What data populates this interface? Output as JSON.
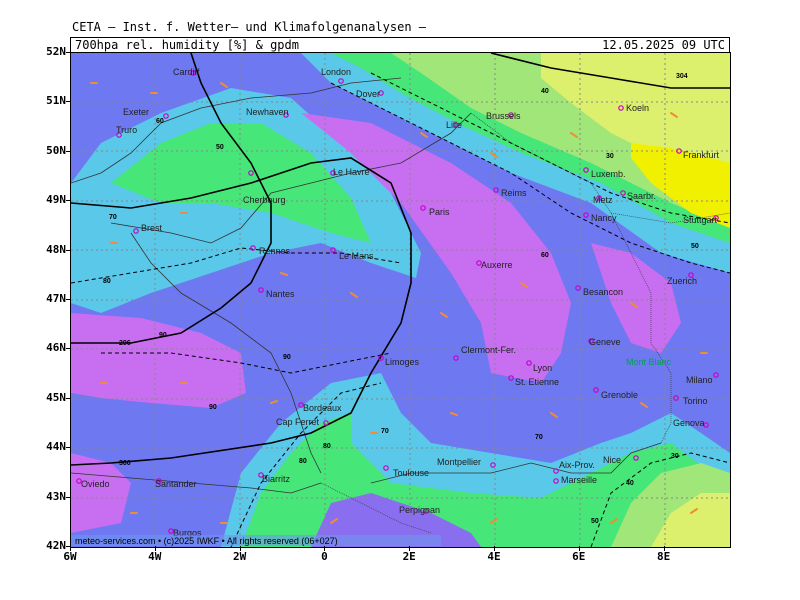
{
  "header": {
    "institute": "CETA — Inst. f. Wetter— und Klimafolgenanalysen —",
    "parameter": "700hpa rel. humidity [%] & gpdm",
    "datetime": "12.05.2025 09 UTC"
  },
  "axes": {
    "lat_labels": [
      "52N",
      "51N",
      "50N",
      "49N",
      "48N",
      "47N",
      "46N",
      "45N",
      "44N",
      "43N",
      "42N"
    ],
    "lon_labels": [
      "6W",
      "4W",
      "2W",
      "0",
      "2E",
      "4E",
      "6E",
      "8E"
    ]
  },
  "footer": {
    "credit": "meteo-services.com • (c)2025 IWKF • All rights reserved (06+027)"
  },
  "colors": {
    "violet": "#c86ef0",
    "slate_blue": "#6e78f0",
    "cornflower": "#6e96f0",
    "blue_violet": "#8a6ef0",
    "cyan": "#5ac8e8",
    "green": "#46e678",
    "light_green": "#a0e678",
    "yellow_green": "#dcf06e",
    "yellow": "#f0f000",
    "city_marker": "#c800c8",
    "wind_arrow": "#f08c32"
  },
  "cities": [
    {
      "name": "Cardiff"
    },
    {
      "name": "London"
    },
    {
      "name": "Dover"
    },
    {
      "name": "Exeter"
    },
    {
      "name": "Newhaven"
    },
    {
      "name": "Truro"
    },
    {
      "name": "Lille"
    },
    {
      "name": "Brussels"
    },
    {
      "name": "Koeln"
    },
    {
      "name": "Frankfurt"
    },
    {
      "name": "Cherbourg"
    },
    {
      "name": "Le Havre"
    },
    {
      "name": "Reims"
    },
    {
      "name": "Luxemb."
    },
    {
      "name": "Saarbr."
    },
    {
      "name": "Metz"
    },
    {
      "name": "Nancy"
    },
    {
      "name": "Stuttgart"
    },
    {
      "name": "Paris"
    },
    {
      "name": "Brest"
    },
    {
      "name": "Rennes"
    },
    {
      "name": "Le Mans"
    },
    {
      "name": "Auxerre"
    },
    {
      "name": "Nantes"
    },
    {
      "name": "Besancon"
    },
    {
      "name": "Zuerich"
    },
    {
      "name": "Geneve"
    },
    {
      "name": "Mont Blanc"
    },
    {
      "name": "Limoges"
    },
    {
      "name": "Clermont-Fer."
    },
    {
      "name": "Lyon"
    },
    {
      "name": "St. Etienne"
    },
    {
      "name": "Grenoble"
    },
    {
      "name": "Milano"
    },
    {
      "name": "Torino"
    },
    {
      "name": "Genova"
    },
    {
      "name": "Bordeaux"
    },
    {
      "name": "Cap Ferret"
    },
    {
      "name": "Nice"
    },
    {
      "name": "Aix-Prov."
    },
    {
      "name": "Montpellier"
    },
    {
      "name": "Toulouse"
    },
    {
      "name": "Marseille"
    },
    {
      "name": "Biarritz"
    },
    {
      "name": "Oviedo"
    },
    {
      "name": "Santander"
    },
    {
      "name": "Perpignan"
    },
    {
      "name": "Burgos"
    }
  ],
  "contour_labels": [
    "50",
    "60",
    "70",
    "80",
    "90",
    "90",
    "80",
    "70",
    "60",
    "50",
    "40",
    "30",
    "70",
    "80",
    "90",
    "50",
    "40",
    "30"
  ],
  "geopotential_labels": [
    "296",
    "300",
    "304"
  ]
}
